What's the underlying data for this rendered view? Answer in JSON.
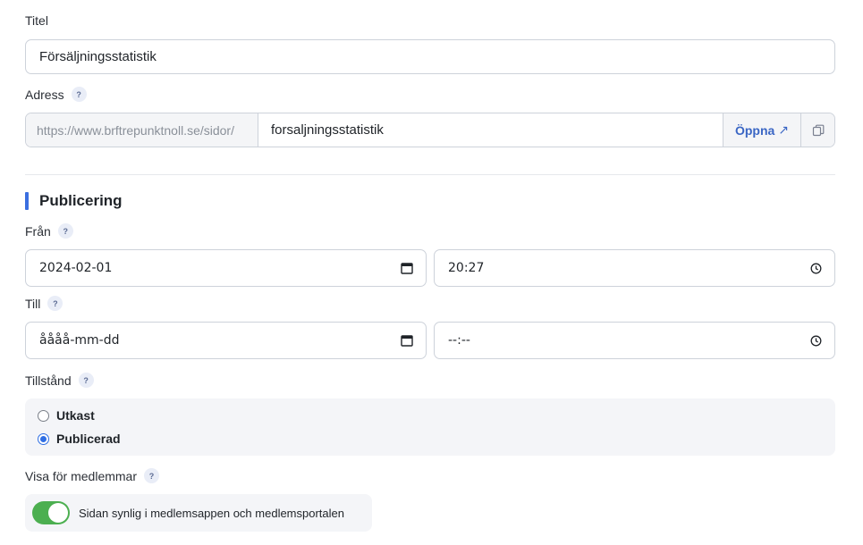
{
  "title_field": {
    "label": "Titel",
    "value": "Försäljningsstatistik"
  },
  "address_field": {
    "label": "Adress",
    "help": "?",
    "prefix": "https://www.brftrepunktnoll.se/sidor/",
    "slug": "forsaljningsstatistik",
    "open_label": "Öppna",
    "open_icon": "↗"
  },
  "publishing": {
    "heading": "Publicering",
    "accent_color": "#3b6fe0",
    "from": {
      "label": "Från",
      "help": "?",
      "date": "2024-02-01",
      "time": "20:27"
    },
    "to": {
      "label": "Till",
      "help": "?",
      "date": "åååå-mm-dd",
      "time": "--:--"
    }
  },
  "state": {
    "label": "Tillstånd",
    "help": "?",
    "options": [
      {
        "label": "Utkast",
        "checked": false
      },
      {
        "label": "Publicerad",
        "checked": true
      }
    ]
  },
  "members": {
    "label": "Visa för medlemmar",
    "help": "?",
    "toggle_on": true,
    "toggle_color": "#4caf50",
    "toggle_text": "Sidan synlig i medlemsappen och medlemsportalen"
  }
}
